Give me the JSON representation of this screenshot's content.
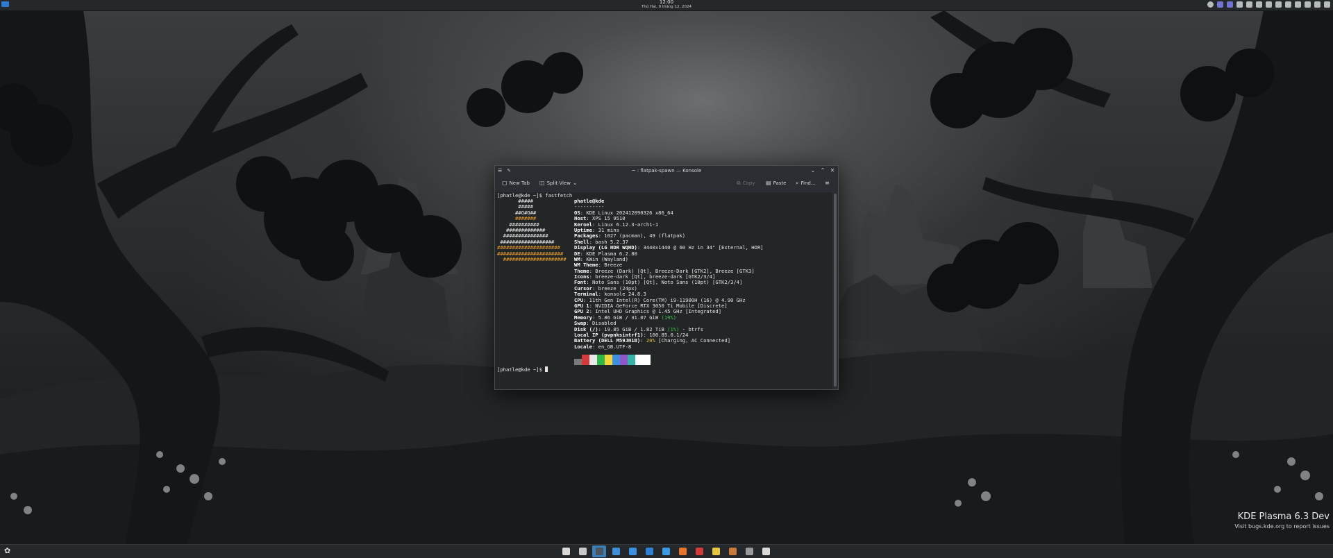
{
  "top_panel": {
    "clock_time": "12:00",
    "clock_date": "Thứ Hai, 9 tháng 12, 2024",
    "tray_icons": [
      "info-icon",
      "discord-icon",
      "vpn-icon",
      "clipboard-icon",
      "notes-icon",
      "battery-icon",
      "camera-icon",
      "volume-icon",
      "network-icon",
      "brightness-icon",
      "bluetooth-icon",
      "display-icon",
      "chevron-up-icon"
    ]
  },
  "window": {
    "title": "~ : flatpak-spawn — Konsole",
    "toolbar": {
      "new_tab": "New Tab",
      "split_view": "Split View",
      "copy": "Copy",
      "paste": "Paste",
      "find": "Find...",
      "menu_icon": "hamburger-menu-icon"
    }
  },
  "terminal": {
    "prompt_cmd": "[phatle@kde ~]$ fastfetch",
    "logo": [
      {
        "t": "       #####",
        "c": "w"
      },
      {
        "t": "       #####",
        "c": "w"
      },
      {
        "t": "      ##O#O##",
        "c": "w"
      },
      {
        "t": "      #######",
        "c": "o"
      },
      {
        "t": "    ##########",
        "c": "w"
      },
      {
        "t": "   #############",
        "c": "w"
      },
      {
        "t": "  ###############",
        "c": "w"
      },
      {
        "t": " ##################",
        "c": "w"
      },
      {
        "t": "##################### ",
        "c": "o"
      },
      {
        "t": "######################",
        "c": "o"
      },
      {
        "t": "  #####################",
        "c": "o"
      }
    ],
    "user_host": "phatle@kde",
    "separator": "----------",
    "info": [
      {
        "k": "OS",
        "v": "KDE Linux 202412090326 x86_64"
      },
      {
        "k": "Host",
        "v": "XPS 15 9510"
      },
      {
        "k": "Kernel",
        "v": "Linux 6.12.3-arch1-1"
      },
      {
        "k": "Uptime",
        "v": "31 mins"
      },
      {
        "k": "Packages",
        "v": "1027 (pacman), 49 (flatpak)"
      },
      {
        "k": "Shell",
        "v": "bash 5.2.37"
      },
      {
        "k": "Display (LG HDR WQHD)",
        "v": "3440x1440 @ 60 Hz in 34\" [External, HDR]"
      },
      {
        "k": "DE",
        "v": "KDE Plasma 6.2.80"
      },
      {
        "k": "WM",
        "v": "KWin (Wayland)"
      },
      {
        "k": "WM Theme",
        "v": "Breeze"
      },
      {
        "k": "Theme",
        "v": "Breeze (Dark) [Qt], Breeze-Dark [GTK2], Breeze [GTK3]"
      },
      {
        "k": "Icons",
        "v": "breeze-dark [Qt], breeze-dark [GTK2/3/4]"
      },
      {
        "k": "Font",
        "v": "Noto Sans (10pt) [Qt], Noto Sans (10pt) [GTK2/3/4]"
      },
      {
        "k": "Cursor",
        "v": "breeze (24px)"
      },
      {
        "k": "Terminal",
        "v": "konsole 24.8.3"
      },
      {
        "k": "CPU",
        "v": "11th Gen Intel(R) Core(TM) i9-11900H (16) @ 4.90 GHz"
      },
      {
        "k": "GPU 1",
        "v": "NVIDIA GeForce RTX 3050 Ti Mobile [Discrete]"
      },
      {
        "k": "GPU 2",
        "v": "Intel UHD Graphics @ 1.45 GHz [Integrated]"
      },
      {
        "k": "Memory",
        "v": "5.86 GiB / 31.07 GiB ",
        "pct": "(19%)",
        "pc": "g"
      },
      {
        "k": "Swap",
        "v": "Disabled"
      },
      {
        "k": "Disk (/)",
        "v": "19.85 GiB / 1.82 TiB ",
        "pct": "(1%)",
        "pc": "g",
        "tail": " - btrfs"
      },
      {
        "k": "Local IP (pvpnksintrf1)",
        "v": "100.85.0.1/24"
      },
      {
        "k": "Battery (DELL M59JH1B)",
        "v": "",
        "pct": "20%",
        "pc": "y",
        "tail": " [Charging, AC Connected]"
      },
      {
        "k": "Locale",
        "v": "en_GB.UTF-8"
      }
    ],
    "palette": [
      "#7a7a7a",
      "#d53a3a",
      "#e9e9e9",
      "#2eb84a",
      "#f3d43a",
      "#3d8fe0",
      "#8f58c9",
      "#36b3a8",
      "#ffffff",
      "#ffffff"
    ],
    "prompt_end": "[phatle@kde ~]$ "
  },
  "watermark": {
    "line1": "KDE Plasma 6.3 Dev",
    "line2": "Visit bugs.kde.org to report issues"
  },
  "taskbar": [
    {
      "name": "overview-icon",
      "color": "#d8d8d8"
    },
    {
      "name": "task-switcher-icon",
      "color": "#c8c8c8"
    },
    {
      "name": "konsole-icon",
      "color": "#4a5560",
      "active": true
    },
    {
      "name": "browser-icon",
      "color": "#3c8fd8"
    },
    {
      "name": "files-icon",
      "color": "#3a8fe0"
    },
    {
      "name": "dolphin-icon",
      "color": "#2f7fd4"
    },
    {
      "name": "discover-icon",
      "color": "#3a9ae6"
    },
    {
      "name": "firefox-icon",
      "color": "#e8752c"
    },
    {
      "name": "pdf-icon",
      "color": "#d33a3a"
    },
    {
      "name": "chrome-icon",
      "color": "#e6c63a"
    },
    {
      "name": "gimp-icon",
      "color": "#c87a3a"
    },
    {
      "name": "app-icon",
      "color": "#9a9a9a"
    },
    {
      "name": "vpn-app-icon",
      "color": "#d9d9d9"
    }
  ]
}
